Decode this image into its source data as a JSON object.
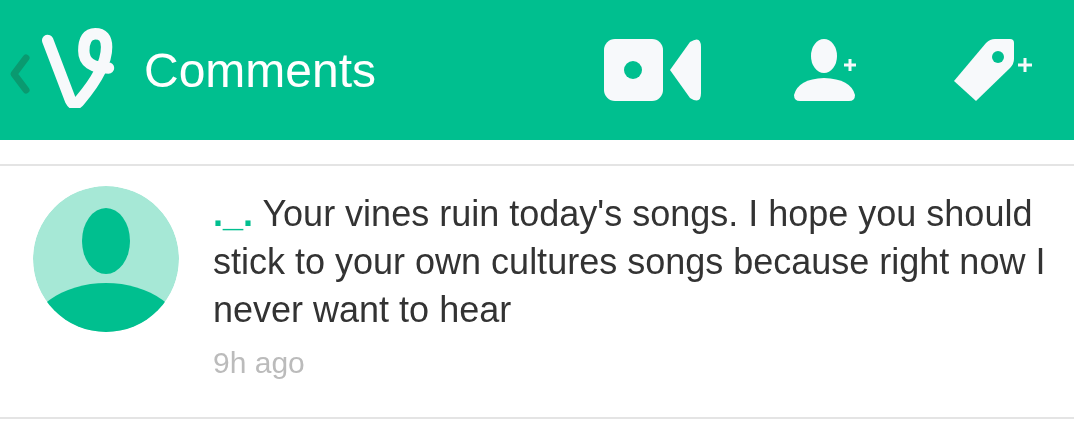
{
  "header": {
    "title": "Comments"
  },
  "comments": [
    {
      "username": "._.",
      "text": "Your vines ruin today's songs. I hope you should stick to your own cultures songs because right now I never want to hear",
      "time": "9h ago"
    }
  ]
}
